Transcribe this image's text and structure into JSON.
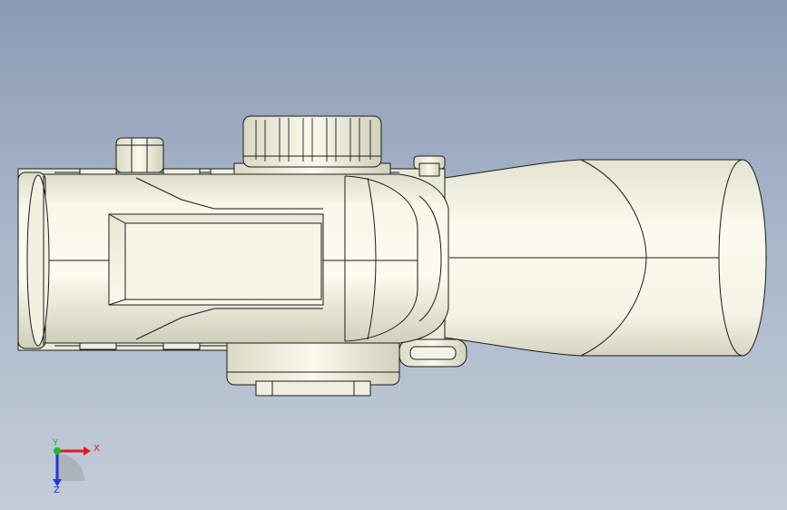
{
  "viewport": {
    "background_top": "#8a9bb4",
    "background_bottom": "#c3ccd8",
    "model_fill": "#f1f1e2",
    "model_shadow": "#c9c9b4",
    "edge_color": "#1c1c1c"
  },
  "triad": {
    "x_label": "X",
    "y_label": "Y",
    "z_label": "Z",
    "x_color": "#e01b1b",
    "y_color": "#1fb52f",
    "z_color": "#2436d8"
  }
}
